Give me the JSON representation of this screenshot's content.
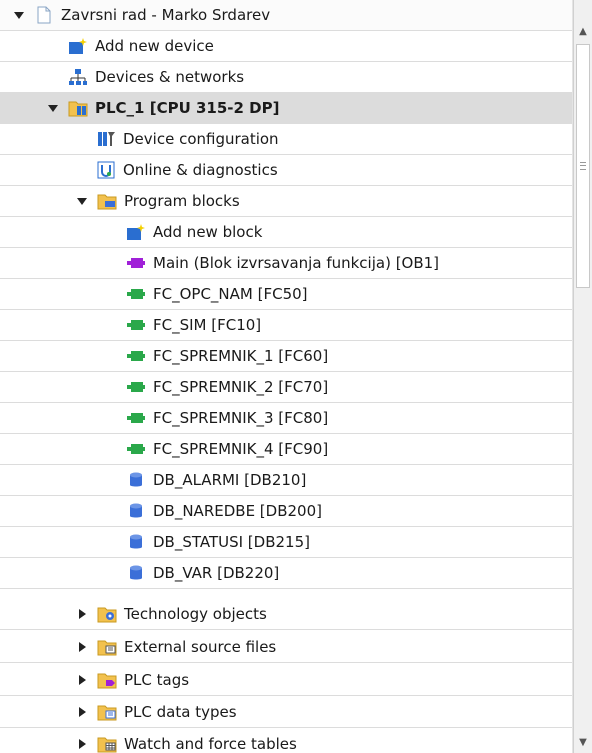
{
  "tree": {
    "project": "Zavrsni rad - Marko Srdarev",
    "add_device": "Add new device",
    "devices_networks": "Devices & networks",
    "plc": "PLC_1 [CPU 315-2 DP]",
    "device_config": "Device configuration",
    "online_diag": "Online & diagnostics",
    "program_blocks": "Program blocks",
    "add_block": "Add new block",
    "blocks": [
      "Main (Blok izvrsavanja funkcija) [OB1]",
      "FC_OPC_NAM [FC50]",
      "FC_SIM [FC10]",
      "FC_SPREMNIK_1 [FC60]",
      "FC_SPREMNIK_2 [FC70]",
      "FC_SPREMNIK_3 [FC80]",
      "FC_SPREMNIK_4 [FC90]",
      "DB_ALARMI [DB210]",
      "DB_NAREDBE [DB200]",
      "DB_STATUSI [DB215]",
      "DB_VAR [DB220]"
    ],
    "technology_objects": "Technology objects",
    "external_sources": "External source files",
    "plc_tags": "PLC tags",
    "plc_data_types": "PLC data types",
    "watch_tables": "Watch and force tables"
  },
  "colors": {
    "selected_row": "#dcdcdc",
    "ob_block": "#a020d8",
    "fc_block": "#2aa84a",
    "db_block": "#3b6fd8",
    "folder": "#f2c14e"
  },
  "scrollbar": {
    "position_fraction": 0.0,
    "visible_fraction": 0.35
  }
}
